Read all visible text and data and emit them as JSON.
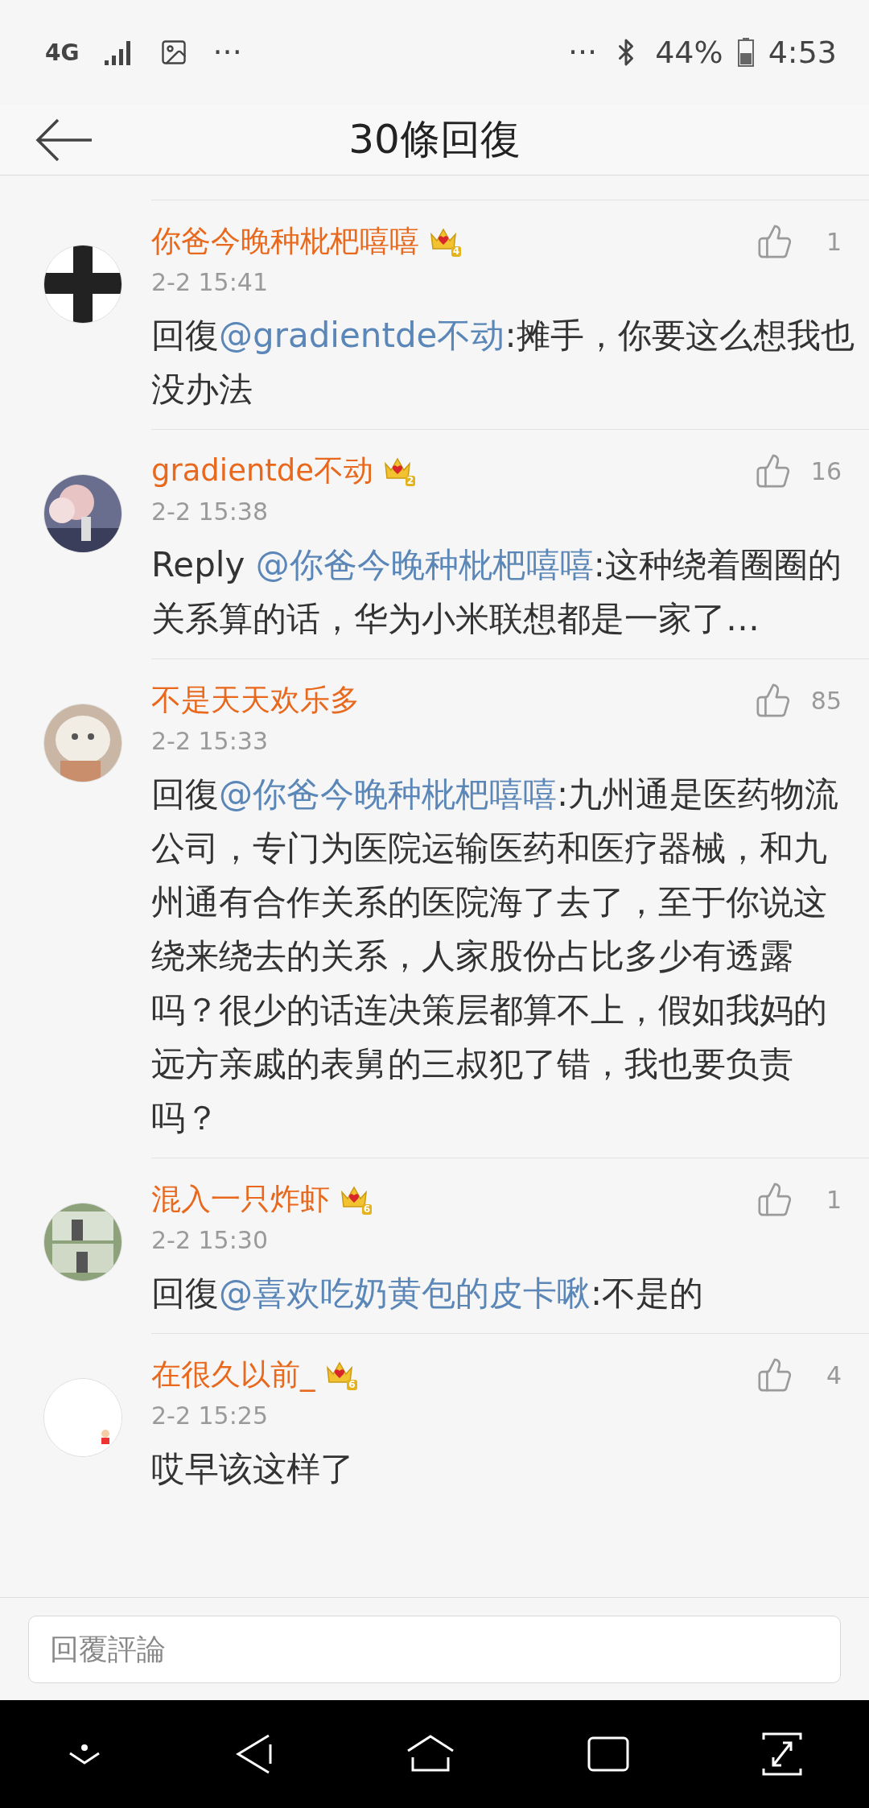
{
  "status_bar": {
    "network": "4G",
    "left_more": "···",
    "right_more": "···",
    "battery": "44%",
    "time": "4:53"
  },
  "header": {
    "title": "30條回復"
  },
  "comments": [
    {
      "name": "你爸今晚种枇杷嘻嘻",
      "vip_level": "4",
      "time": "2-2 15:41",
      "likes": "1",
      "reply_prefix": "回復",
      "mention": "@gradientde不动",
      "text": ":摊手，你要这么想我也没办法"
    },
    {
      "name": "gradientde不动",
      "vip_level": "2",
      "time": "2-2 15:38",
      "likes": "16",
      "reply_prefix": "Reply ",
      "mention": "@你爸今晚种枇杷嘻嘻",
      "text": ":这种绕着圈圈的关系算的话，华为小米联想都是一家了…"
    },
    {
      "name": "不是天天欢乐多",
      "time": "2-2 15:33",
      "likes": "85",
      "reply_prefix": "回復",
      "mention": "@你爸今晚种枇杷嘻嘻",
      "text": ":九州通是医药物流公司，专门为医院运输医药和医疗器械，和九州通有合作关系的医院海了去了，至于你说这绕来绕去的关系，人家股份占比多少有透露吗？很少的话连决策层都算不上，假如我妈的远方亲戚的表舅的三叔犯了错，我也要负责吗？"
    },
    {
      "name": "混入一只炸虾",
      "vip_level": "6",
      "time": "2-2 15:30",
      "likes": "1",
      "reply_prefix": "回復",
      "mention": "@喜欢吃奶黄包的皮卡啾",
      "text": ":不是的"
    },
    {
      "name": "在很久以前_",
      "vip_level": "6",
      "time": "2-2 15:25",
      "likes": "4",
      "text": "哎早该这样了"
    }
  ],
  "reply_box": {
    "placeholder": "回覆評論"
  }
}
